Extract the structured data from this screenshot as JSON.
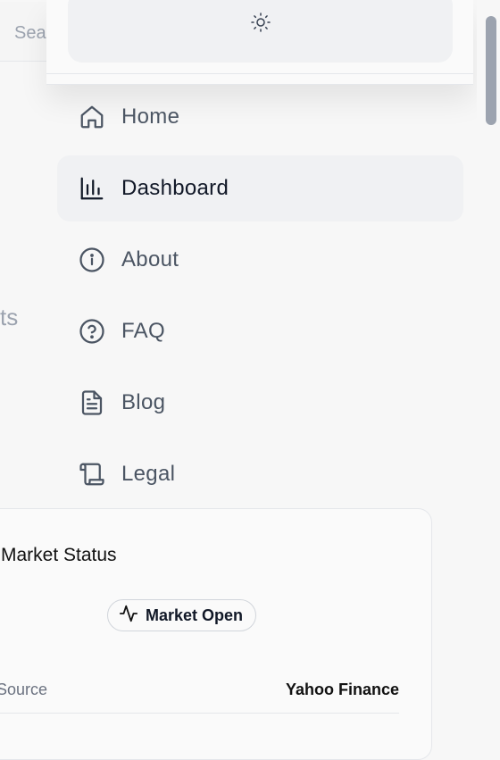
{
  "background": {
    "search_placeholder": "Sea",
    "fragment_text": "ts",
    "market_card": {
      "title": "Market Status",
      "badge_label": "Market Open",
      "row_label": "n Source",
      "row_value": "Yahoo Finance"
    }
  },
  "menu": {
    "theme_toggle_icon": "sun-icon",
    "items": [
      {
        "label": "Home",
        "icon": "home-icon",
        "active": false
      },
      {
        "label": "Dashboard",
        "icon": "bar-chart-icon",
        "active": true
      },
      {
        "label": "About",
        "icon": "info-icon",
        "active": false
      },
      {
        "label": "FAQ",
        "icon": "help-circle-icon",
        "active": false
      },
      {
        "label": "Blog",
        "icon": "file-text-icon",
        "active": false
      },
      {
        "label": "Legal",
        "icon": "scroll-icon",
        "active": false
      }
    ]
  },
  "colors": {
    "active_bg": "#f0f1f3",
    "text_muted": "#4b5563",
    "text_active": "#111827",
    "border": "#e5e7eb"
  }
}
